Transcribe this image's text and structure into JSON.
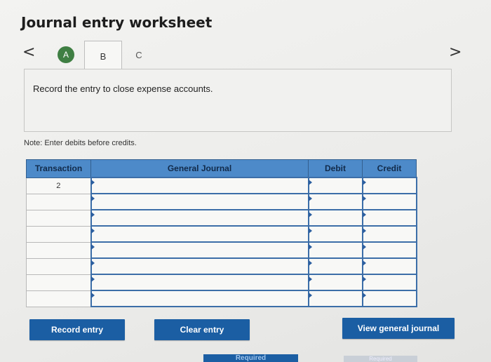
{
  "title": "Journal entry worksheet",
  "nav": {
    "prev_icon": "chevron-left-icon",
    "next_icon": "chevron-right-icon",
    "prev": "<",
    "next": ">"
  },
  "tabs": [
    {
      "label": "A",
      "state": "completed"
    },
    {
      "label": "B",
      "state": "active"
    },
    {
      "label": "C",
      "state": "inactive"
    }
  ],
  "prompt": "Record the entry to close expense accounts.",
  "note": "Note: Enter debits before credits.",
  "journal": {
    "headers": [
      "Transaction",
      "General Journal",
      "Debit",
      "Credit"
    ],
    "first_transaction": "2",
    "row_count": 8
  },
  "buttons": {
    "record": "Record entry",
    "clear": "Clear entry",
    "view": "View general journal"
  },
  "bottom_nav": {
    "prev": "Required",
    "next": "Required"
  },
  "colors": {
    "header_blue": "#4d8ac9",
    "button_blue": "#1b5ea3",
    "tab_green": "#3f7f43"
  }
}
